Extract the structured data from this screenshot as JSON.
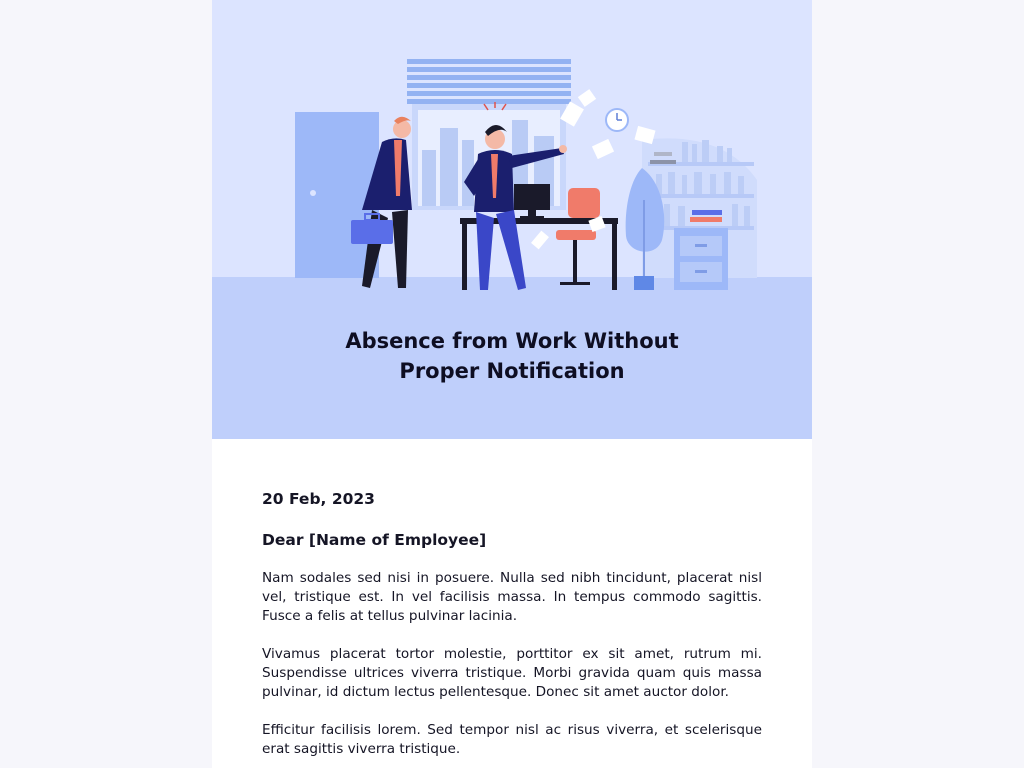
{
  "letter": {
    "title_line1": "Absence from Work Without",
    "title_line2": "Proper Notification",
    "date": "20 Feb, 2023",
    "greeting": "Dear [Name of Employee]",
    "paragraphs": [
      "Nam sodales sed nisi in posuere. Nulla sed nibh tincidunt, placerat nisl vel, tristique est. In vel facilisis massa. In tempus commodo sagittis. Fusce a felis at tellus pulvinar lacinia.",
      "Vivamus placerat tortor molestie, porttitor ex sit amet, rutrum mi. Suspendisse ultrices viverra tristique. Morbi gravida quam quis massa pulvinar, id dictum lectus pellentesque. Donec sit amet auctor dolor.",
      "Efficitur facilisis lorem. Sed tempor nisl ac risus viverra, et scelerisque erat sagittis viverra tristique."
    ]
  },
  "illustration": {
    "icon": "angry-boss-office-illustration",
    "colors": {
      "background": "#dce4ff",
      "floor": "#bfcffb",
      "suit": "#1b1f6e",
      "accent": "#f07b6a",
      "furniture": "#9db8f8"
    }
  }
}
